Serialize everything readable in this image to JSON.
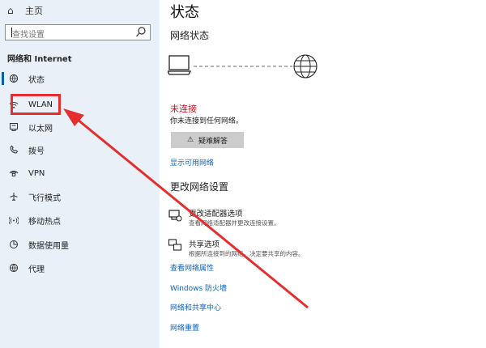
{
  "sidebar": {
    "home_label": "主页",
    "search_placeholder": "查找设置",
    "section_title": "网络和 Internet",
    "items": [
      {
        "label": "状态",
        "icon": "globe-icon"
      },
      {
        "label": "WLAN",
        "icon": "wifi-icon"
      },
      {
        "label": "以太网",
        "icon": "ethernet-icon"
      },
      {
        "label": "拨号",
        "icon": "dial-up-icon"
      },
      {
        "label": "VPN",
        "icon": "vpn-icon"
      },
      {
        "label": "飞行模式",
        "icon": "airplane-icon"
      },
      {
        "label": "移动热点",
        "icon": "hotspot-icon"
      },
      {
        "label": "数据使用量",
        "icon": "data-usage-icon"
      },
      {
        "label": "代理",
        "icon": "proxy-globe-icon"
      }
    ]
  },
  "main": {
    "page_title": "状态",
    "network_status_heading": "网络状态",
    "connection_status": "未连接",
    "connection_desc": "你未连接到任何网络。",
    "troubleshoot_label": "疑难解答",
    "show_networks_link": "显示可用网络",
    "change_settings_heading": "更改网络设置",
    "options": [
      {
        "title": "更改适配器选项",
        "desc": "查看网络适配器并更改连接设置。",
        "icon": "adapter-icon"
      },
      {
        "title": "共享选项",
        "desc": "根据所连接到的网络，决定要共享的内容。",
        "icon": "sharing-icon"
      }
    ],
    "links": [
      "查看网络属性",
      "Windows 防火墙",
      "网络和共享中心",
      "网络重置"
    ]
  },
  "colors": {
    "sidebar_bg": "#e9f0f7",
    "accent": "#0b64c0",
    "error": "#c50f1f",
    "annotation": "#e52e2e"
  }
}
